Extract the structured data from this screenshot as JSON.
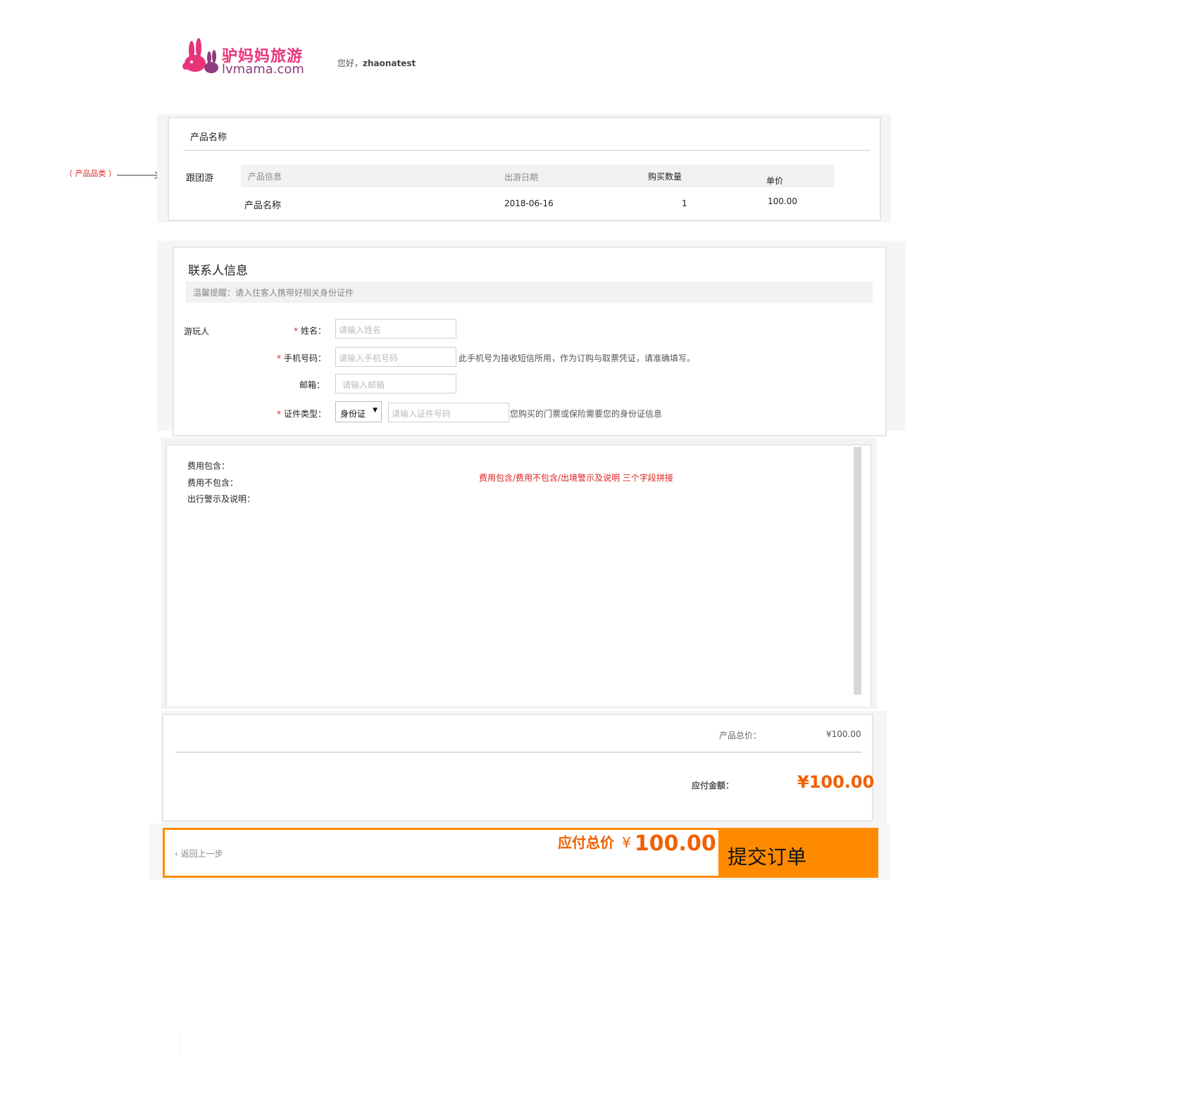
{
  "header": {
    "logo_cn": "驴妈妈旅游",
    "logo_en": "lvmama.com",
    "greeting_prefix": "您好，",
    "username": "zhaonatest"
  },
  "annotation": {
    "category_label": "（ 产品品类 ）"
  },
  "product": {
    "title": "产品名称",
    "category": "跟团游",
    "columns": [
      "产品信息",
      "出游日期",
      "购买数量",
      "单价"
    ],
    "row": {
      "name": "产品名称",
      "date": "2018-06-16",
      "quantity": "1",
      "price": "100.00"
    }
  },
  "contact": {
    "title": "联系人信息",
    "tip": "温馨提醒：请入住客人携带好相关身份证件",
    "traveler_label": "游玩人",
    "name_label": "姓名：",
    "name_placeholder": "请输入姓名",
    "phone_label": "手机号码：",
    "phone_placeholder": "请输入手机号码",
    "phone_hint": "此手机号为接收短信所用，作为订购与取票凭证，请准确填写。",
    "email_label": "邮箱：",
    "email_placeholder": "请输入邮箱",
    "id_type_label": "证件类型：",
    "id_type_value": "身份证",
    "id_placeholder": "请输入证件号码",
    "id_hint": "您购买的门票或保险需要您的身份证信息",
    "required_mark": "*"
  },
  "fees": {
    "included_label": "费用包含：",
    "excluded_label": "费用不包含：",
    "notice_label": "出行警示及说明：",
    "note": "费用包含/费用不包含/出境警示及说明 三个字段拼接"
  },
  "summary": {
    "product_total_label": "产品总价：",
    "product_total_value": "¥100.00",
    "payable_label": "应付金额：",
    "payable_value": "¥100.00"
  },
  "footer": {
    "back_link": "返回上一步",
    "back_icon": "chevron-left-icon",
    "total_label": "应付总价",
    "currency": "¥",
    "total_value": "100.00",
    "submit_label": "提交订单"
  },
  "colors": {
    "accent": "#ff8a00",
    "price": "#f06000",
    "brand": "#e8357a",
    "alert": "#e02020"
  }
}
